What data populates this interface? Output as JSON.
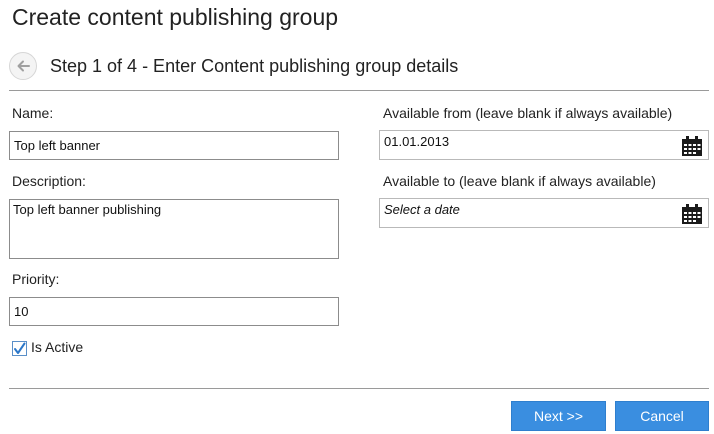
{
  "header": {
    "title": "Create content publishing group",
    "step_title": "Step 1 of 4 - Enter Content publishing group details"
  },
  "form": {
    "name": {
      "label": "Name:",
      "value": "Top left banner"
    },
    "description": {
      "label": "Description:",
      "value": "Top left banner publishing"
    },
    "priority": {
      "label": "Priority:",
      "value": "10"
    },
    "is_active": {
      "label": "Is Active",
      "checked": true
    },
    "available_from": {
      "label": "Available from (leave blank if always available)",
      "value": "01.01.2013"
    },
    "available_to": {
      "label": "Available to (leave blank if always available)",
      "placeholder": "Select a date"
    }
  },
  "buttons": {
    "next": "Next >>",
    "cancel": "Cancel"
  },
  "icons": {
    "back": "arrow-left-icon",
    "calendar": "calendar-icon",
    "check": "check-icon"
  },
  "colors": {
    "button_bg": "#3a8ee0",
    "rule": "#9a9a9a"
  }
}
